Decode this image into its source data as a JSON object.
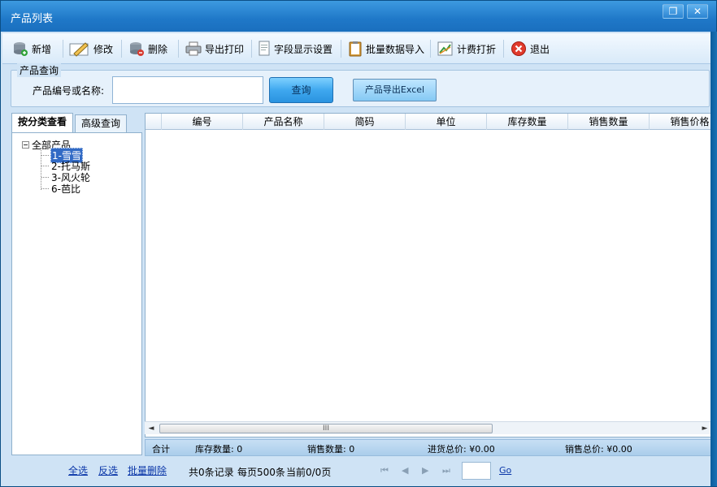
{
  "window": {
    "title": "产品列表",
    "restore_glyph": "❐",
    "close_glyph": "✕"
  },
  "toolbar": {
    "add": "新增",
    "edit": "修改",
    "delete": "删除",
    "export_print": "导出打印",
    "field_settings": "字段显示设置",
    "batch_import": "批量数据导入",
    "discount": "计费打折",
    "exit": "退出"
  },
  "query": {
    "legend": "产品查询",
    "label": "产品编号或名称:",
    "input_value": "",
    "search_button": "查询",
    "export_button": "产品导出Excel"
  },
  "tabs": {
    "by_category": "按分类查看",
    "advanced": "高级查询"
  },
  "tree": {
    "root": "全部产品",
    "items": [
      {
        "label": "1-雪雪",
        "selected": true
      },
      {
        "label": "2-托马斯",
        "selected": false
      },
      {
        "label": "3-风火轮",
        "selected": false
      },
      {
        "label": "6-芭比",
        "selected": false
      }
    ]
  },
  "grid": {
    "columns": [
      "",
      "编号",
      "产品名称",
      "简码",
      "单位",
      "库存数量",
      "销售数量",
      "销售价格"
    ]
  },
  "scroll": {
    "left": "◄",
    "right": "►",
    "grip": "III"
  },
  "summary": {
    "label": "合计",
    "stock": "库存数量: 0",
    "sales": "销售数量: 0",
    "purchase_total": "进货总价: ¥0.00",
    "sales_total": "销售总价: ¥0.00"
  },
  "footer": {
    "select_all": "全选",
    "invert": "反选",
    "batch_delete": "批量删除",
    "records": "共0条记录",
    "per_page": "每页500条",
    "current": "当前0/0页",
    "first": "⏮",
    "prev": "◀",
    "next": "▶",
    "last": "⏭",
    "page_value": "",
    "go": "Go"
  },
  "colors": {
    "accent": "#1f78c8",
    "panel": "#cfe3f5",
    "link": "#0a36a8"
  }
}
